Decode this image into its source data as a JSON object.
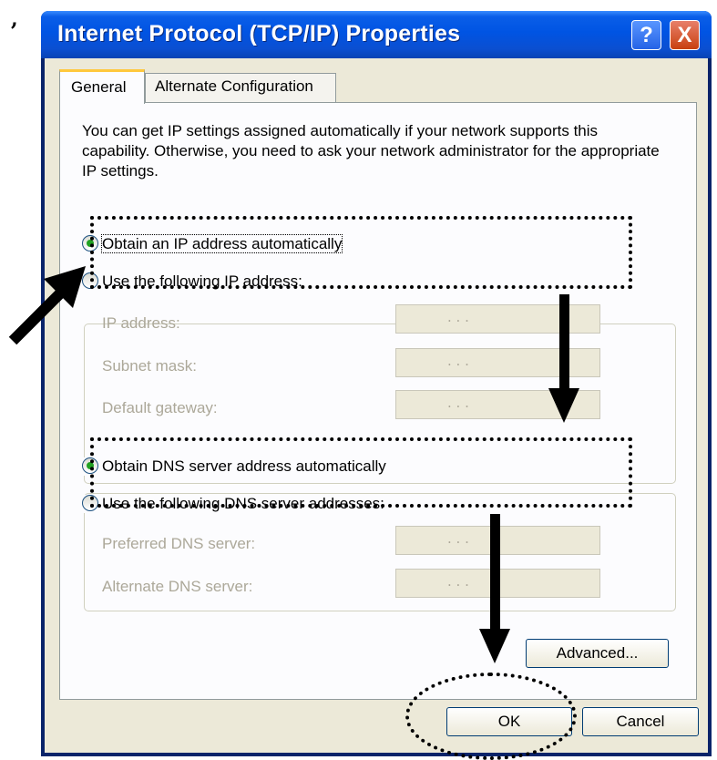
{
  "corner_mark": ",",
  "window": {
    "title": "Internet Protocol (TCP/IP) Properties",
    "help_label": "?",
    "close_label": "X"
  },
  "tabs": [
    {
      "label": "General",
      "selected": true
    },
    {
      "label": "Alternate Configuration",
      "selected": false
    }
  ],
  "description": "You can get IP settings assigned automatically if your network supports this capability. Otherwise, you need to ask your network administrator for the appropriate IP settings.",
  "ip_section": {
    "obtain_auto_label": "Obtain an IP address automatically",
    "use_following_label": "Use the following IP address:",
    "fields": [
      {
        "label": "IP address:",
        "value": ".  .  ."
      },
      {
        "label": "Subnet mask:",
        "value": ".  .  ."
      },
      {
        "label": "Default gateway:",
        "value": ".  .  ."
      }
    ]
  },
  "dns_section": {
    "obtain_auto_label": "Obtain DNS server address automatically",
    "use_following_label": "Use the following DNS server addresses:",
    "fields": [
      {
        "label": "Preferred DNS server:",
        "value": ".  .  ."
      },
      {
        "label": "Alternate DNS server:",
        "value": ".  .  ."
      }
    ]
  },
  "buttons": {
    "advanced": "Advanced...",
    "ok": "OK",
    "cancel": "Cancel"
  },
  "colors": {
    "title_bar": "#0054e3",
    "dialog_bg": "#ece9d8",
    "disabled_text": "#aca899",
    "radio_dot": "#21a121",
    "tab_highlight": "#ffc83c"
  }
}
